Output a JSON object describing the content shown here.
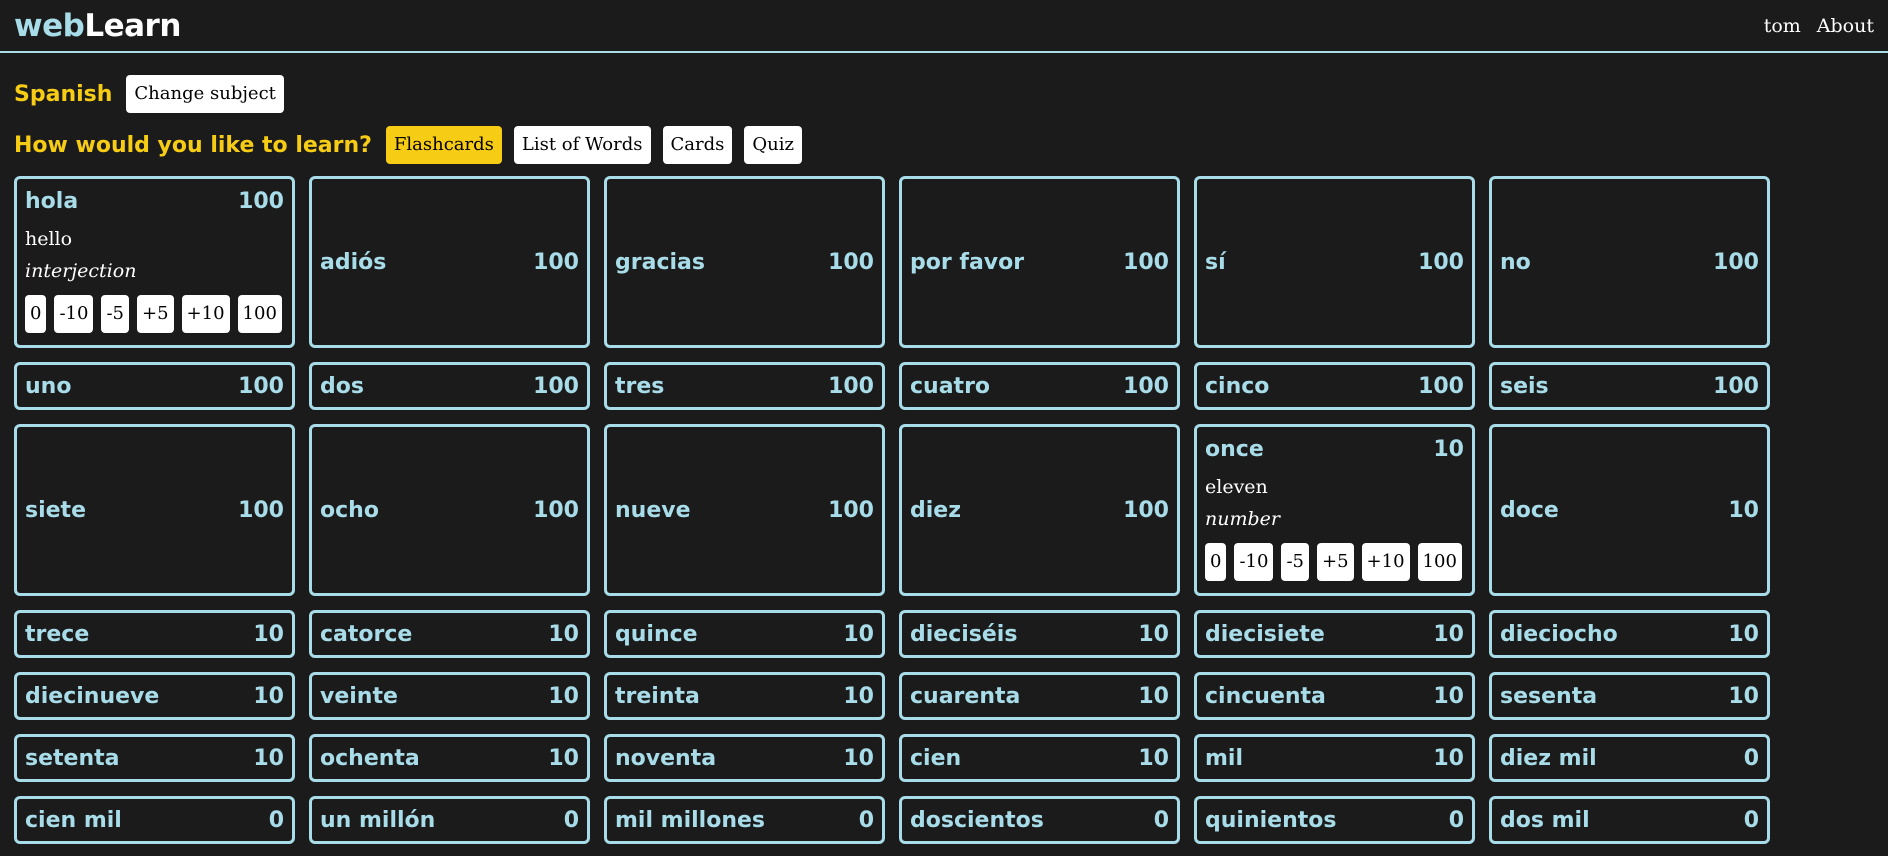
{
  "app": {
    "logo_part1": "web",
    "logo_part2": "Learn",
    "nav": [
      "tom",
      "About"
    ]
  },
  "subject": {
    "name": "Spanish",
    "change_label": "Change subject"
  },
  "learn": {
    "prompt": "How would you like to learn?",
    "modes": [
      {
        "label": "Flashcards",
        "active": true
      },
      {
        "label": "List of Words",
        "active": false
      },
      {
        "label": "Cards",
        "active": false
      },
      {
        "label": "Quiz",
        "active": false
      }
    ]
  },
  "score_buttons": [
    "0",
    "-10",
    "-5",
    "+5",
    "+10",
    "100"
  ],
  "colors": {
    "background": "#1b1b1b",
    "accent": "#a8dce8",
    "highlight": "#f7cc15"
  },
  "cards": [
    {
      "word": "hola",
      "score": "100",
      "expanded": true,
      "meaning": "hello",
      "pos": "interjection",
      "tall": true
    },
    {
      "word": "adiós",
      "score": "100",
      "tall": true
    },
    {
      "word": "gracias",
      "score": "100",
      "tall": true
    },
    {
      "word": "por favor",
      "score": "100",
      "tall": true
    },
    {
      "word": "sí",
      "score": "100",
      "tall": true
    },
    {
      "word": "no",
      "score": "100",
      "tall": true
    },
    {
      "word": "uno",
      "score": "100"
    },
    {
      "word": "dos",
      "score": "100"
    },
    {
      "word": "tres",
      "score": "100"
    },
    {
      "word": "cuatro",
      "score": "100"
    },
    {
      "word": "cinco",
      "score": "100"
    },
    {
      "word": "seis",
      "score": "100"
    },
    {
      "word": "siete",
      "score": "100",
      "tall": true
    },
    {
      "word": "ocho",
      "score": "100",
      "tall": true
    },
    {
      "word": "nueve",
      "score": "100",
      "tall": true
    },
    {
      "word": "diez",
      "score": "100",
      "tall": true
    },
    {
      "word": "once",
      "score": "10",
      "expanded": true,
      "meaning": "eleven",
      "pos": "number",
      "tall": true
    },
    {
      "word": "doce",
      "score": "10",
      "tall": true
    },
    {
      "word": "trece",
      "score": "10"
    },
    {
      "word": "catorce",
      "score": "10"
    },
    {
      "word": "quince",
      "score": "10"
    },
    {
      "word": "dieciséis",
      "score": "10"
    },
    {
      "word": "diecisiete",
      "score": "10"
    },
    {
      "word": "dieciocho",
      "score": "10"
    },
    {
      "word": "diecinueve",
      "score": "10"
    },
    {
      "word": "veinte",
      "score": "10"
    },
    {
      "word": "treinta",
      "score": "10"
    },
    {
      "word": "cuarenta",
      "score": "10"
    },
    {
      "word": "cincuenta",
      "score": "10"
    },
    {
      "word": "sesenta",
      "score": "10"
    },
    {
      "word": "setenta",
      "score": "10"
    },
    {
      "word": "ochenta",
      "score": "10"
    },
    {
      "word": "noventa",
      "score": "10"
    },
    {
      "word": "cien",
      "score": "10"
    },
    {
      "word": "mil",
      "score": "10"
    },
    {
      "word": "diez mil",
      "score": "0"
    },
    {
      "word": "cien mil",
      "score": "0"
    },
    {
      "word": "un millón",
      "score": "0"
    },
    {
      "word": "mil millones",
      "score": "0"
    },
    {
      "word": "doscientos",
      "score": "0"
    },
    {
      "word": "quinientos",
      "score": "0"
    },
    {
      "word": "dos mil",
      "score": "0"
    }
  ]
}
